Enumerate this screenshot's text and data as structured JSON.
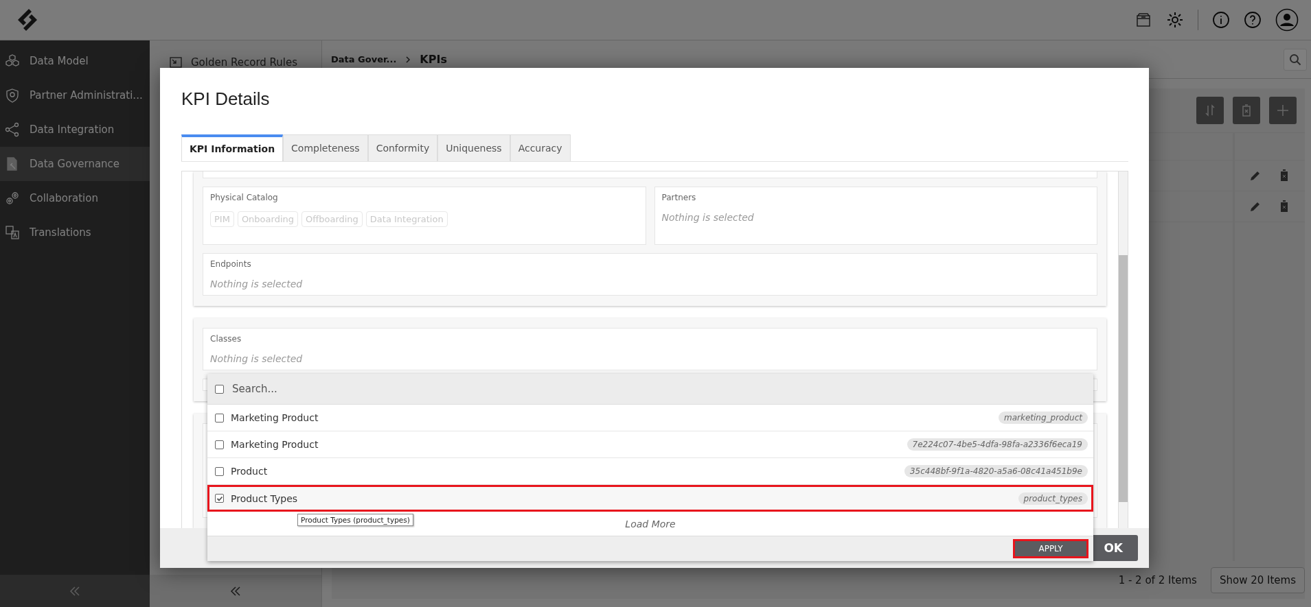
{
  "sidebar": {
    "items": [
      {
        "label": "Data Model",
        "selected": false
      },
      {
        "label": "Partner Administrati...",
        "selected": false
      },
      {
        "label": "Data Integration",
        "selected": false
      },
      {
        "label": "Data Governance",
        "selected": true
      },
      {
        "label": "Collaboration",
        "selected": false
      },
      {
        "label": "Translations",
        "selected": false
      }
    ]
  },
  "subnav": {
    "items": [
      {
        "label": "Golden Record Rules"
      }
    ]
  },
  "breadcrumb": [
    "Data Gover...",
    "KPIs"
  ],
  "pagination": {
    "summary": "1 - 2 of 2 Items",
    "page_size_button": "Show 20 Items"
  },
  "dialog": {
    "title": "KPI Details",
    "tabs": [
      {
        "label": "KPI Information",
        "selected": true
      },
      {
        "label": "Completeness",
        "selected": false
      },
      {
        "label": "Conformity",
        "selected": false
      },
      {
        "label": "Uniqueness",
        "selected": false
      },
      {
        "label": "Accuracy",
        "selected": false
      }
    ],
    "physical_catalog": {
      "label": "Physical Catalog",
      "chips": [
        "PIM",
        "Onboarding",
        "Offboarding",
        "Data Integration"
      ]
    },
    "partners": {
      "label": "Partners",
      "placeholder": "Nothing is selected"
    },
    "endpoints": {
      "label": "Endpoints",
      "placeholder": "Nothing is selected"
    },
    "classes": {
      "label": "Classes",
      "placeholder": "Nothing is selected"
    },
    "ok_button": "OK"
  },
  "dropdown": {
    "search": {
      "placeholder": "Search...",
      "checked": false
    },
    "options": [
      {
        "label": "Marketing Product",
        "tag": "marketing_product",
        "checked": false,
        "highlighted": false
      },
      {
        "label": "Marketing Product",
        "tag": "7e224c07-4be5-4dfa-98fa-a2336f6eca19",
        "checked": false,
        "highlighted": false
      },
      {
        "label": "Product",
        "tag": "35c448bf-9f1a-4820-a5a6-08c41a451b9e",
        "checked": false,
        "highlighted": false
      },
      {
        "label": "Product Types",
        "tag": "product_types",
        "checked": true,
        "highlighted": true
      }
    ],
    "load_more": "Load More",
    "tooltip": "Product Types (product_types)",
    "apply_button": {
      "label": "APPLY",
      "highlighted": true
    }
  }
}
